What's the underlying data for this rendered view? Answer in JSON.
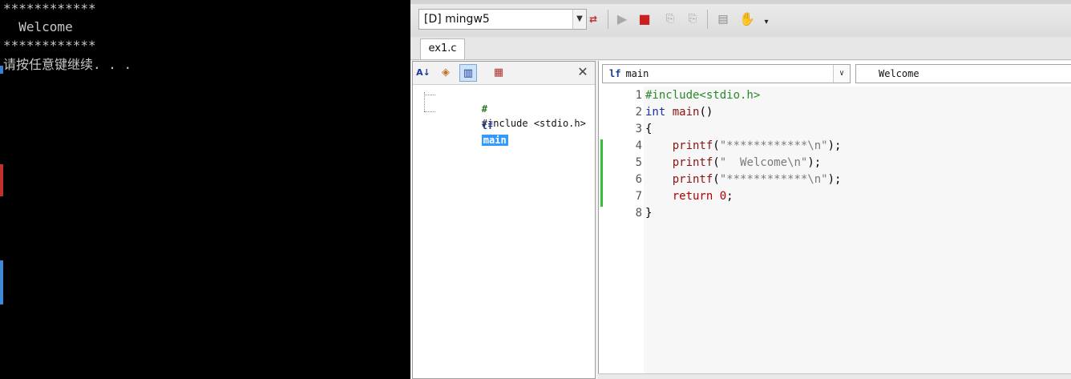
{
  "console": {
    "lines": [
      "************",
      "  Welcome",
      "************",
      "请按任意键继续. . ."
    ]
  },
  "ide": {
    "toolbar": {
      "compiler": "[D] mingw5",
      "icons": [
        "rebuild-icon",
        "run-icon",
        "stop-icon",
        "step-icon",
        "step-out-icon",
        "document-icon",
        "hand-icon",
        "more-icon"
      ]
    },
    "tabs": [
      {
        "label": "ex1.c"
      }
    ],
    "class_view": {
      "items": [
        {
          "icon": "#",
          "label": "#include <stdio.h>"
        },
        {
          "icon": "lf",
          "label": "main"
        }
      ]
    },
    "editor": {
      "function_combo": "main",
      "scope_combo": "Welcome",
      "line_numbers": [
        "1",
        "2",
        "3",
        "4",
        "5",
        "6",
        "7",
        "8"
      ],
      "lines": [
        [
          {
            "t": "#include<stdio.h>",
            "c": "pp"
          }
        ],
        [
          {
            "t": "int",
            "c": "kw"
          },
          {
            "t": " "
          },
          {
            "t": "main",
            "c": "fnc"
          },
          {
            "t": "()"
          }
        ],
        [
          {
            "t": "{"
          }
        ],
        [
          {
            "t": "    "
          },
          {
            "t": "printf",
            "c": "fnc"
          },
          {
            "t": "("
          },
          {
            "t": "\"************\\n\"",
            "c": "str"
          },
          {
            "t": ");"
          }
        ],
        [
          {
            "t": "    "
          },
          {
            "t": "printf",
            "c": "fnc"
          },
          {
            "t": "("
          },
          {
            "t": "\"  Welcome\\n\"",
            "c": "str"
          },
          {
            "t": ");"
          }
        ],
        [
          {
            "t": "    "
          },
          {
            "t": "printf",
            "c": "fnc"
          },
          {
            "t": "("
          },
          {
            "t": "\"************\\n\"",
            "c": "str"
          },
          {
            "t": ");"
          }
        ],
        [
          {
            "t": "    "
          },
          {
            "t": "return",
            "c": "ret"
          },
          {
            "t": " "
          },
          {
            "t": "0",
            "c": "num"
          },
          {
            "t": ";"
          }
        ],
        [
          {
            "t": "}"
          }
        ]
      ]
    }
  }
}
